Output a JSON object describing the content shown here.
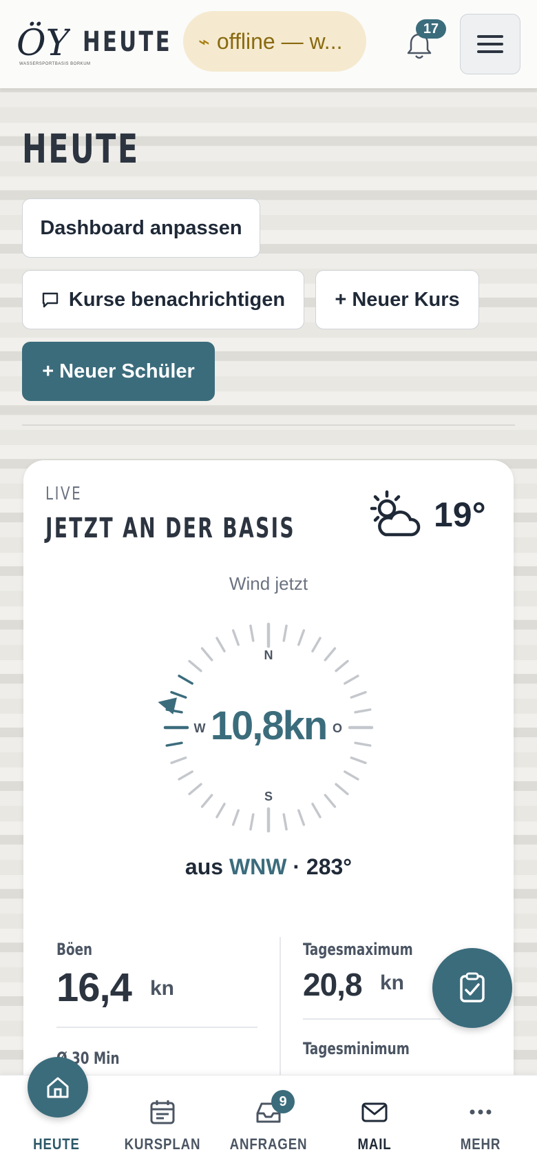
{
  "header": {
    "brand_title": "HEUTE",
    "logo_text": "ÖY",
    "logo_subtitle": "WASSERSPORTBASIS BORKUM",
    "offline_text": "offline — w...",
    "notification_count": "17",
    "icons": {
      "offline": "bolt-icon",
      "notifications": "bell-icon",
      "menu": "hamburger-icon"
    }
  },
  "page": {
    "title": "HEUTE",
    "actions": {
      "dashboard": "Dashboard anpassen",
      "notify": "Kurse benachrichtigen",
      "new_course": "+ Neuer Kurs",
      "new_student": "+ Neuer Schüler"
    }
  },
  "weather": {
    "live_label": "LIVE",
    "title": "JETZT AN DER BASIS",
    "temperature": "19°",
    "condition_icon": "partly-cloudy-icon",
    "wind_label": "Wind jetzt",
    "wind_speed": "10,8kn",
    "compass": {
      "n": "N",
      "s": "S",
      "w": "W",
      "o": "O"
    },
    "wind_direction_degrees": 283,
    "wind_from_prefix": "aus",
    "wind_from_dir": "WNW",
    "wind_from_deg": "· 283°",
    "stats": {
      "gusts_label": "Böen",
      "gusts_value": "16,4",
      "gusts_unit": "kn",
      "avg_label": "Ø 30 Min",
      "daymax_label": "Tagesmaximum",
      "daymax_value": "20,8",
      "daymax_unit": "kn",
      "daymin_label": "Tagesminimum"
    }
  },
  "fab": {
    "icon": "clipboard-check-icon"
  },
  "bottom_nav": {
    "items": [
      {
        "label": "HEUTE",
        "icon": "home-icon"
      },
      {
        "label": "KURSPLAN",
        "icon": "calendar-icon"
      },
      {
        "label": "ANFRAGEN",
        "icon": "inbox-icon",
        "badge": "9"
      },
      {
        "label": "MAIL",
        "icon": "mail-icon"
      },
      {
        "label": "MEHR",
        "icon": "more-dots-icon"
      }
    ]
  },
  "colors": {
    "accent": "#3b6c7c",
    "offline_bg": "#f5ead0",
    "offline_text": "#8a6a10"
  }
}
